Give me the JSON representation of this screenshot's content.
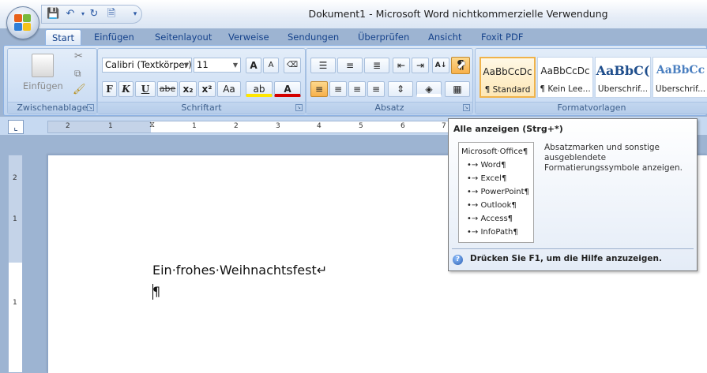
{
  "window": {
    "title": "Dokument1 - Microsoft Word nichtkommerzielle Verwendung"
  },
  "qat": {
    "items": [
      {
        "icon": "save-icon"
      },
      {
        "icon": "undo-icon"
      },
      {
        "icon": "redo-icon"
      },
      {
        "icon": "print-preview-icon"
      },
      {
        "icon": "customize-icon"
      }
    ]
  },
  "tabs": [
    "Start",
    "Einfügen",
    "Seitenlayout",
    "Verweise",
    "Sendungen",
    "Überprüfen",
    "Ansicht",
    "Foxit PDF"
  ],
  "ribbon": {
    "clipboard": {
      "label": "Zwischenablage",
      "paste": "Einfügen"
    },
    "font": {
      "label": "Schriftart",
      "name": "Calibri (Textkörper)",
      "size": "11",
      "bold": "F",
      "italic": "K",
      "underline": "U",
      "strike": "abe",
      "sub": "x₂",
      "sup": "x²",
      "case": "Aa",
      "grow": "A",
      "shrink": "A"
    },
    "paragraph": {
      "label": "Absatz"
    },
    "styles": {
      "label": "Formatvorlagen",
      "items": [
        {
          "sample": "AaBbCcDc",
          "name": "¶ Standard"
        },
        {
          "sample": "AaBbCcDc",
          "name": "¶ Kein Lee..."
        },
        {
          "sample": "AaBbC(",
          "name": "Überschrif..."
        },
        {
          "sample": "AaBbCc",
          "name": "Überschrif..."
        }
      ]
    }
  },
  "ruler": {
    "h_labels": [
      "2",
      "1",
      "1",
      "2",
      "3",
      "4",
      "5",
      "6",
      "7"
    ],
    "v_labels": [
      "2",
      "1",
      "1"
    ]
  },
  "document": {
    "line1": "Ein·frohes·Weihnachtsfest↵",
    "line2": "¶"
  },
  "tooltip": {
    "title": "Alle anzeigen (Strg+*)",
    "preview": [
      "Microsoft·Office¶",
      "•→ Word¶",
      "•→ Excel¶",
      "•→ PowerPoint¶",
      "•→ Outlook¶",
      "•→ Access¶",
      "•→ InfoPath¶"
    ],
    "description": "Absatzmarken und sonstige ausgeblendete Formatierungssymbole anzeigen.",
    "help": "Drücken Sie F1, um die Hilfe anzuzeigen."
  }
}
